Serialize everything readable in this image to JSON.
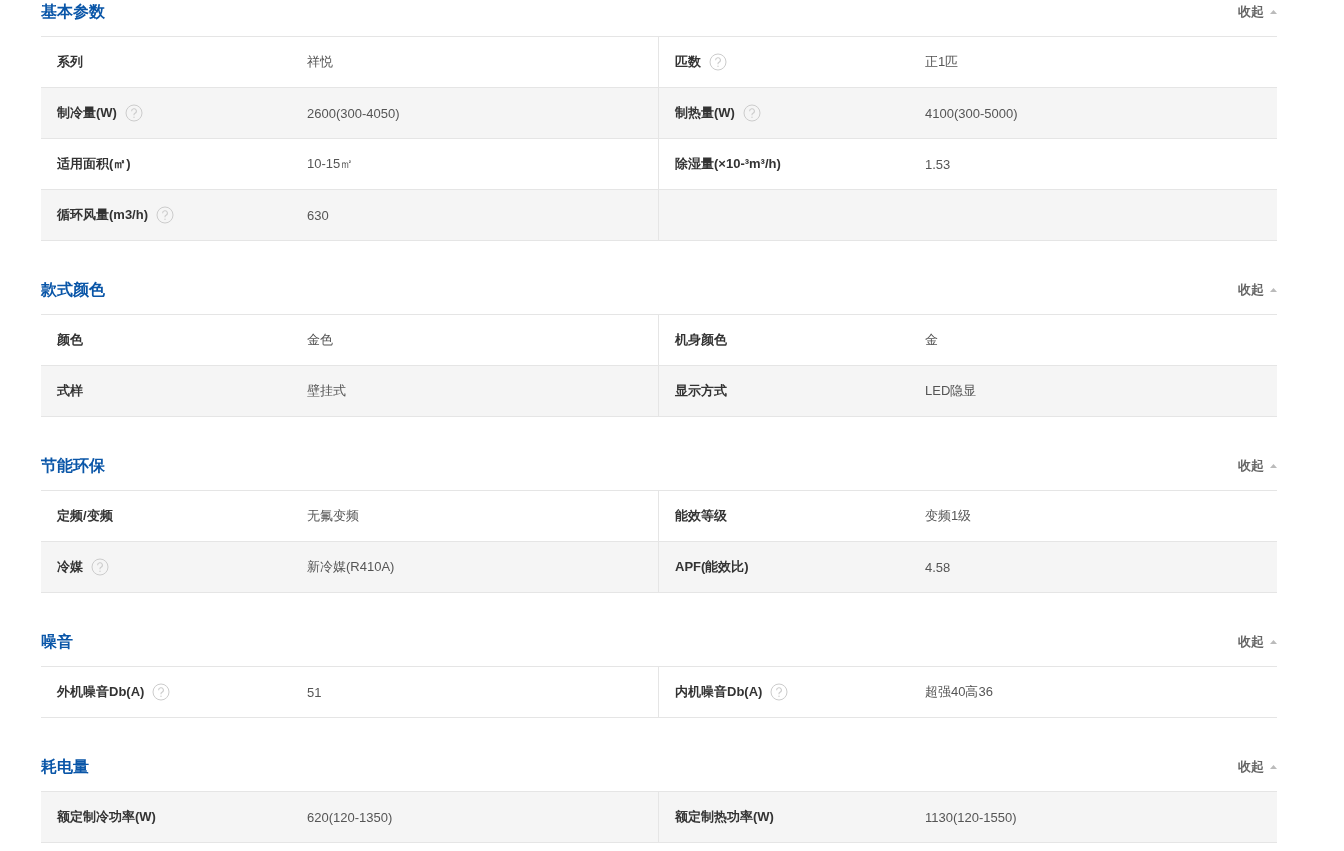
{
  "sections": [
    {
      "title": "基本参数",
      "toggle": "收起",
      "rows": [
        {
          "cells": [
            {
              "label": "系列",
              "help": false,
              "value": "祥悦"
            },
            {
              "label": "匹数",
              "help": true,
              "value": "正1匹"
            }
          ]
        },
        {
          "cells": [
            {
              "label": "制冷量(W)",
              "help": true,
              "value": "2600(300-4050)"
            },
            {
              "label": "制热量(W)",
              "help": true,
              "value": "4100(300-5000)"
            }
          ]
        },
        {
          "cells": [
            {
              "label": "适用面积(㎡)",
              "help": false,
              "value": "10-15㎡"
            },
            {
              "label": "除湿量(×10-³m³/h)",
              "help": false,
              "value": "1.53"
            }
          ]
        },
        {
          "cells": [
            {
              "label": "循环风量(m3/h)",
              "help": true,
              "value": "630"
            }
          ]
        }
      ]
    },
    {
      "title": "款式颜色",
      "toggle": "收起",
      "rows": [
        {
          "cells": [
            {
              "label": "颜色",
              "help": false,
              "value": "金色"
            },
            {
              "label": "机身颜色",
              "help": false,
              "value": "金"
            }
          ]
        },
        {
          "cells": [
            {
              "label": "式样",
              "help": false,
              "value": "壁挂式"
            },
            {
              "label": "显示方式",
              "help": false,
              "value": "LED隐显"
            }
          ]
        }
      ]
    },
    {
      "title": "节能环保",
      "toggle": "收起",
      "rows": [
        {
          "cells": [
            {
              "label": "定频/变频",
              "help": false,
              "value": "无氟变频"
            },
            {
              "label": "能效等级",
              "help": false,
              "value": "变频1级"
            }
          ]
        },
        {
          "cells": [
            {
              "label": "冷媒",
              "help": true,
              "value": "新冷媒(R410A)"
            },
            {
              "label": "APF(能效比)",
              "help": false,
              "value": "4.58"
            }
          ]
        }
      ]
    },
    {
      "title": "噪音",
      "toggle": "收起",
      "rows": [
        {
          "cells": [
            {
              "label": "外机噪音Db(A)",
              "help": true,
              "value": "51"
            },
            {
              "label": "内机噪音Db(A)",
              "help": true,
              "value": "超强40高36"
            }
          ]
        }
      ]
    },
    {
      "title": "耗电量",
      "toggle": "收起",
      "rows": [
        {
          "cells": [
            {
              "label": "额定制冷功率(W)",
              "help": false,
              "value": "620(120-1350)"
            },
            {
              "label": "额定制热功率(W)",
              "help": false,
              "value": "1130(120-1550)"
            }
          ]
        }
      ]
    }
  ]
}
